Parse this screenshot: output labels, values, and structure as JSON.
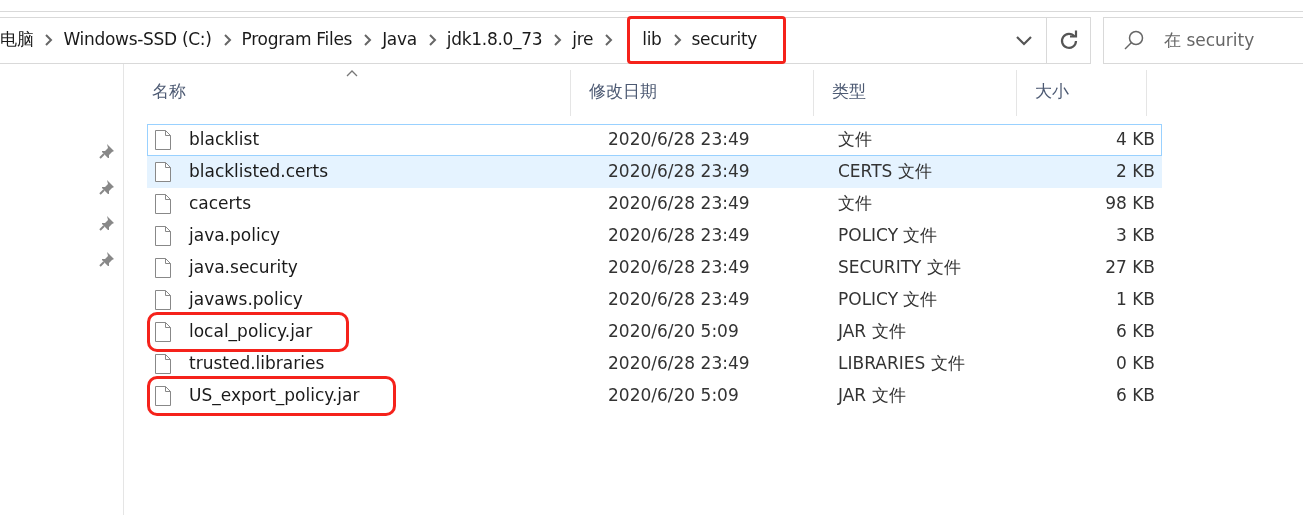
{
  "address_bar": {
    "breadcrumb": [
      {
        "label": "电脑",
        "highlighted": false
      },
      {
        "label": "Windows-SSD (C:)",
        "highlighted": false
      },
      {
        "label": "Program Files",
        "highlighted": false
      },
      {
        "label": "Java",
        "highlighted": false
      },
      {
        "label": "jdk1.8.0_73",
        "highlighted": false
      },
      {
        "label": "jre",
        "highlighted": false
      },
      {
        "label": "lib",
        "highlighted": true
      },
      {
        "label": "security",
        "highlighted": true
      }
    ]
  },
  "search": {
    "placeholder": "在 security"
  },
  "table": {
    "columns": [
      {
        "label": "名称",
        "sorted": true
      },
      {
        "label": "修改日期",
        "sorted": false
      },
      {
        "label": "类型",
        "sorted": false
      },
      {
        "label": "大小",
        "sorted": false
      }
    ],
    "rows": [
      {
        "name": "blacklist",
        "date": "2020/6/28 23:49",
        "type": "文件",
        "size": "4 KB",
        "focused": true,
        "selected": false,
        "highlighted": false
      },
      {
        "name": "blacklisted.certs",
        "date": "2020/6/28 23:49",
        "type": "CERTS 文件",
        "size": "2 KB",
        "focused": false,
        "selected": true,
        "highlighted": false
      },
      {
        "name": "cacerts",
        "date": "2020/6/28 23:49",
        "type": "文件",
        "size": "98 KB",
        "focused": false,
        "selected": false,
        "highlighted": false
      },
      {
        "name": "java.policy",
        "date": "2020/6/28 23:49",
        "type": "POLICY 文件",
        "size": "3 KB",
        "focused": false,
        "selected": false,
        "highlighted": false
      },
      {
        "name": "java.security",
        "date": "2020/6/28 23:49",
        "type": "SECURITY 文件",
        "size": "27 KB",
        "focused": false,
        "selected": false,
        "highlighted": false
      },
      {
        "name": "javaws.policy",
        "date": "2020/6/28 23:49",
        "type": "POLICY 文件",
        "size": "1 KB",
        "focused": false,
        "selected": false,
        "highlighted": false
      },
      {
        "name": "local_policy.jar",
        "date": "2020/6/20 5:09",
        "type": "JAR 文件",
        "size": "6 KB",
        "focused": false,
        "selected": false,
        "highlighted": true
      },
      {
        "name": "trusted.libraries",
        "date": "2020/6/28 23:49",
        "type": "LIBRARIES 文件",
        "size": "0 KB",
        "focused": false,
        "selected": false,
        "highlighted": false
      },
      {
        "name": "US_export_policy.jar",
        "date": "2020/6/20 5:09",
        "type": "JAR 文件",
        "size": "6 KB",
        "focused": false,
        "selected": false,
        "highlighted": true
      }
    ]
  }
}
